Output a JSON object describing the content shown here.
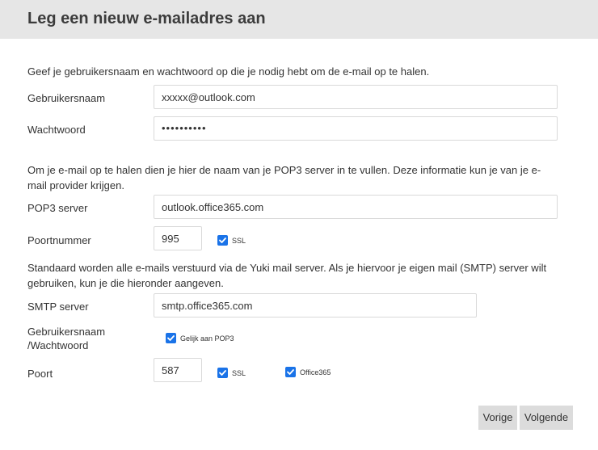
{
  "dialog": {
    "title": "Leg een nieuw e-mailadres aan"
  },
  "account": {
    "intro": "Geef je gebruikersnaam en wachtwoord op die je nodig hebt om de e-mail op te halen.",
    "username_label": "Gebruikersnaam",
    "username_value": "xxxxx@outlook.com",
    "password_label": "Wachtwoord",
    "password_value": "••••••••••"
  },
  "pop3": {
    "intro": "Om je e-mail op te halen dien je hier de naam van je POP3 server in te vullen. Deze informatie kun je van je e-mail provider krijgen.",
    "server_label": "POP3 server",
    "server_value": "outlook.office365.com",
    "port_label": "Poortnummer",
    "port_value": "995",
    "ssl_label": "SSL",
    "ssl_checked": true
  },
  "smtp": {
    "intro": "Standaard worden alle e-mails verstuurd via de Yuki mail server. Als je hiervoor je eigen mail (SMTP) server wilt gebruiken, kun je die hieronder aangeven.",
    "server_label": "SMTP server",
    "server_value": "smtp.office365.com",
    "credentials_label_line1": "Gebruikersnaam",
    "credentials_label_line2": "/Wachtwoord",
    "same_as_pop3_label": "Gelijk aan POP3",
    "same_as_pop3_checked": true,
    "port_label": "Poort",
    "port_value": "587",
    "ssl_label": "SSL",
    "ssl_checked": true,
    "office365_label": "Office365",
    "office365_checked": true
  },
  "buttons": {
    "previous": "Vorige",
    "next": "Volgende"
  },
  "colors": {
    "header_bg": "#e6e6e6",
    "checkbox_blue": "#1a73e8",
    "button_bg": "#dcdcdc"
  }
}
